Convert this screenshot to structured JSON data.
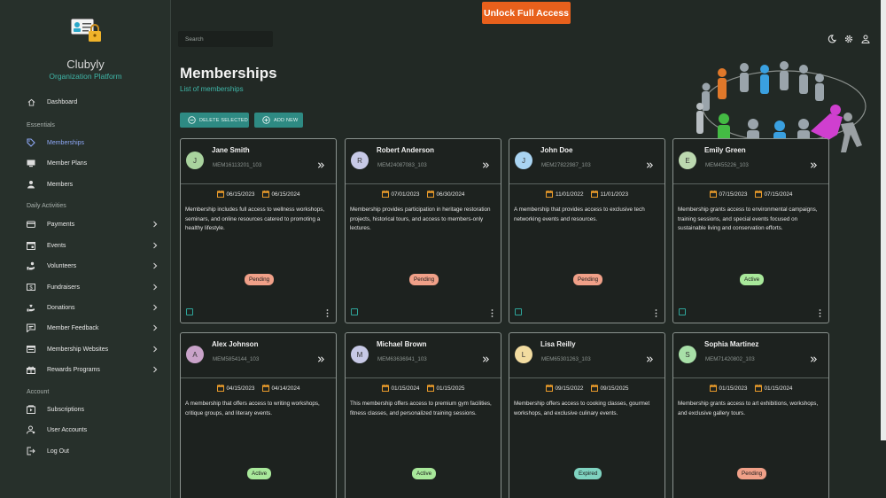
{
  "brand": {
    "name": "Clubyly",
    "subtitle": "Organization Platform"
  },
  "sidebar": {
    "dashboard": "Dashboard",
    "sections": [
      "Essentials",
      "Daily Activities",
      "Account"
    ],
    "essentials": [
      "Memberships",
      "Member Plans",
      "Members"
    ],
    "daily": [
      "Payments",
      "Events",
      "Volunteers",
      "Fundraisers",
      "Donations",
      "Member Feedback",
      "Membership Websites",
      "Rewards Programs"
    ],
    "account": [
      "Subscriptions",
      "User Accounts",
      "Log Out"
    ]
  },
  "header": {
    "unlock_label": "Unlock Full Access",
    "search_placeholder": "Search"
  },
  "page": {
    "title": "Memberships",
    "subtitle": "List of memberships"
  },
  "toolbar": {
    "delete_label": "DELETE SELECTED",
    "add_label": "ADD NEW"
  },
  "colors": {
    "accent": "#2e8a83",
    "unlock": "#e8601c",
    "active_nav": "#8ea8f7",
    "pending": "#f0a088",
    "active": "#a8e89a",
    "expired": "#7fd3c0"
  },
  "cards": [
    {
      "initial": "J",
      "name": "Jane Smith",
      "id": "MEM16113201_103",
      "start": "06/15/2023",
      "end": "06/15/2024",
      "desc": "Membership includes full access to wellness workshops, seminars, and online resources catered to promoting a healthy lifestyle.",
      "status": "Pending",
      "avatar_color": "#a9d39e"
    },
    {
      "initial": "R",
      "name": "Robert Anderson",
      "id": "MEM24087083_103",
      "start": "07/01/2023",
      "end": "06/30/2024",
      "desc": "Membership provides participation in heritage restoration projects, historical tours, and access to members-only lectures.",
      "status": "Pending",
      "avatar_color": "#c7c9e6"
    },
    {
      "initial": "J",
      "name": "John Doe",
      "id": "MEM27822987_103",
      "start": "11/01/2022",
      "end": "11/01/2023",
      "desc": "A membership that provides access to exclusive tech networking events and resources.",
      "status": "Pending",
      "avatar_color": "#a9d4f2"
    },
    {
      "initial": "E",
      "name": "Emily Green",
      "id": "MEM455226_103",
      "start": "07/15/2023",
      "end": "07/15/2024",
      "desc": "Membership grants access to environmental campaigns, training sessions, and special events focused on sustainable living and conservation efforts.",
      "status": "Active",
      "avatar_color": "#bcd9b0"
    },
    {
      "initial": "A",
      "name": "Alex Johnson",
      "id": "MEM5854144_103",
      "start": "04/15/2023",
      "end": "04/14/2024",
      "desc": "A membership that offers access to writing workshops, critique groups, and literary events.",
      "status": "Active",
      "avatar_color": "#c9a3c9"
    },
    {
      "initial": "M",
      "name": "Michael Brown",
      "id": "MEM63636941_103",
      "start": "01/15/2024",
      "end": "01/15/2025",
      "desc": "This membership offers access to premium gym facilities, fitness classes, and personalized training sessions.",
      "status": "Active",
      "avatar_color": "#c7c9e6"
    },
    {
      "initial": "L",
      "name": "Lisa Reilly",
      "id": "MEM65301263_103",
      "start": "09/15/2022",
      "end": "09/15/2025",
      "desc": "Membership offers access to cooking classes, gourmet workshops, and exclusive culinary events.",
      "status": "Expired",
      "avatar_color": "#f2dca0"
    },
    {
      "initial": "S",
      "name": "Sophia Martinez",
      "id": "MEM71420802_103",
      "start": "01/15/2023",
      "end": "01/15/2024",
      "desc": "Membership grants access to art exhibitions, workshops, and exclusive gallery tours.",
      "status": "Pending",
      "avatar_color": "#a8e0a8"
    }
  ]
}
